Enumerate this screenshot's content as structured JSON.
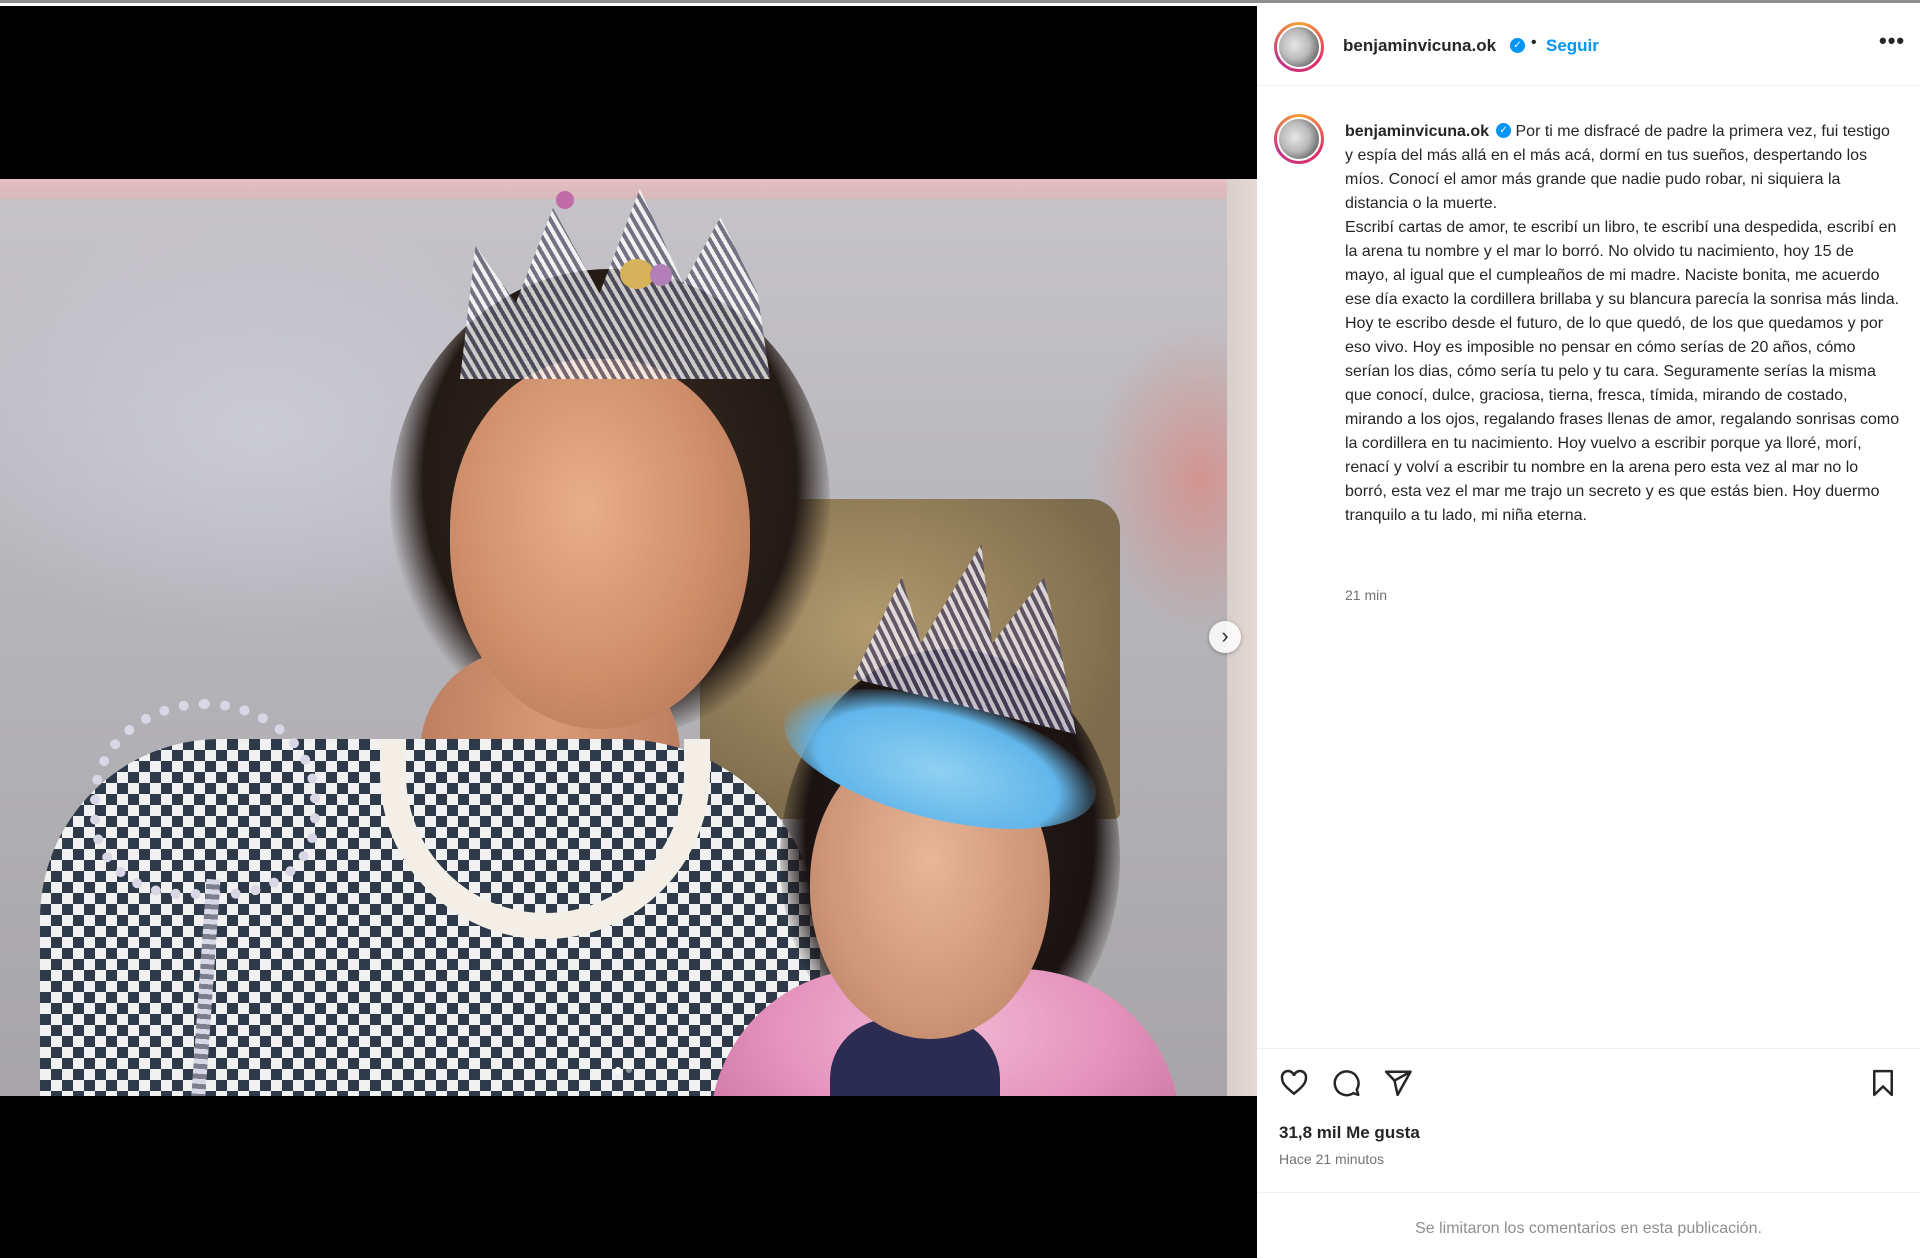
{
  "post": {
    "username": "benjaminvicuna.ok",
    "verified_icon": "verified-badge-icon",
    "separator": "•",
    "follow_label": "Seguir",
    "more_icon": "more-options-icon",
    "more_glyph": "•••",
    "caption_username": "benjaminvicuna.ok",
    "caption_line1": "Por ti me disfracé de padre la primera vez, fui testigo y espía del más allá en el más acá, dormí en tus sueños, despertando los míos. Conocí el amor más grande que nadie pudo robar, ni siquiera la distancia o la muerte.",
    "caption_line2": "Escribí cartas de amor, te escribí un libro, te escribí una despedida, escribí en la arena tu nombre y el mar lo borró. No olvido tu nacimiento, hoy 15 de mayo, al igual que el cumpleaños de mi madre. Naciste bonita, me acuerdo ese día exacto la cordillera brillaba y su blancura parecía la sonrisa más linda. Hoy te escribo desde el futuro, de lo que quedó, de los que quedamos y por eso vivo. Hoy es imposible no pensar en cómo serías de 20 años, cómo serían los dias, cómo sería tu pelo y tu cara. Seguramente serías la misma que conocí, dulce, graciosa, tierna, fresca, tímida, mirando de costado, mirando a los ojos, regalando frases llenas de amor, regalando sonrisas como la cordillera en tu nacimiento. Hoy vuelvo a escribir porque ya lloré, morí, renací y volví a escribir tu nombre en la arena pero esta vez al mar no lo borró, esta vez el mar me trajo un secreto y es que estás bien. Hoy duermo tranquilo a tu lado, mi niña eterna.",
    "caption_time": "21 min",
    "likes": "31,8 mil Me gusta",
    "posted_ago": "Hace 21 minutos",
    "comments_notice": "Se limitaron los comentarios en esta publicación."
  },
  "media": {
    "next_glyph": "›",
    "carousel_dots": 2,
    "active_dot": 0
  },
  "icons": {
    "like": "heart-icon",
    "comment": "comment-icon",
    "share": "share-icon",
    "save": "bookmark-icon"
  },
  "colors": {
    "accent": "#0095f6",
    "text": "#262626",
    "muted": "#737373",
    "media_bg": "#000000"
  }
}
